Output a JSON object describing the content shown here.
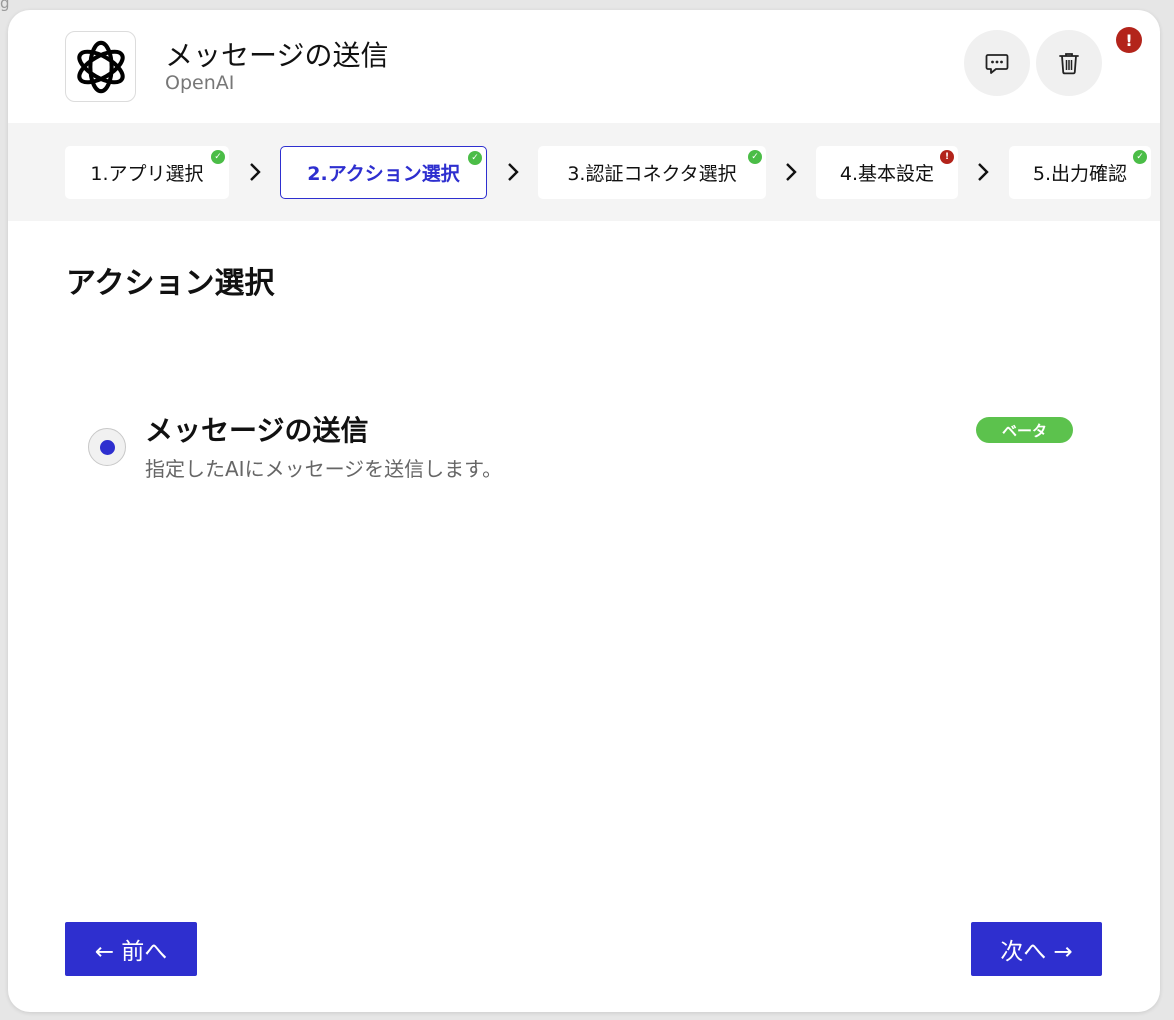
{
  "background_glyph": "g",
  "header": {
    "title": "メッセージの送信",
    "app_name": "OpenAI",
    "logo_icon": "openai-logo-icon",
    "comment_icon": "comment-icon",
    "trash_icon": "trash-icon",
    "error_badge": "!"
  },
  "steps": [
    {
      "label": "1.アプリ選択",
      "status": "ok",
      "active": false
    },
    {
      "label": "2.アクション選択",
      "status": "ok",
      "active": true
    },
    {
      "label": "3.認証コネクタ選択",
      "status": "ok",
      "active": false
    },
    {
      "label": "4.基本設定",
      "status": "error",
      "active": false
    },
    {
      "label": "5.出力確認",
      "status": "ok",
      "active": false
    }
  ],
  "section_title": "アクション選択",
  "action": {
    "title": "メッセージの送信",
    "description": "指定したAIにメッセージを送信します。",
    "badge": "ベータ",
    "selected": true
  },
  "footer": {
    "prev_label": "← 前へ",
    "next_label": "次へ →"
  },
  "colors": {
    "primary": "#2e2fcf",
    "success": "#4bbd47",
    "error": "#b3241b",
    "beta": "#5cc24d"
  }
}
